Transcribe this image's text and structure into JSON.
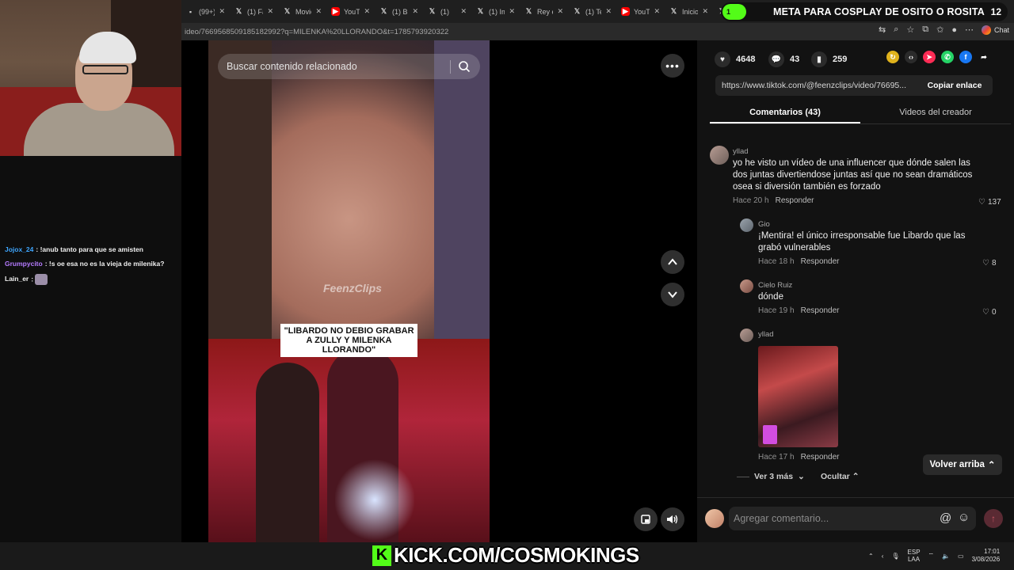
{
  "browser": {
    "tabs": [
      {
        "label": "(99+)",
        "icon": "generic-icon"
      },
      {
        "label": "(1) Fac",
        "icon": "x-icon"
      },
      {
        "label": "Movie",
        "icon": "x-icon"
      },
      {
        "label": "YouTu",
        "icon": "youtube-icon"
      },
      {
        "label": "(1) Bu",
        "icon": "x-icon"
      },
      {
        "label": "(1) ",
        "icon": "x-icon"
      },
      {
        "label": "(1) Im",
        "icon": "x-icon"
      },
      {
        "label": "Rey e",
        "icon": "x-icon"
      },
      {
        "label": "(1) Te",
        "icon": "x-icon"
      },
      {
        "label": "YouTu",
        "icon": "youtube-icon"
      },
      {
        "label": "Inicio",
        "icon": "x-icon"
      },
      {
        "label": "",
        "icon": "x-icon"
      }
    ],
    "url": "ideo/7669568509185182992?q=MILENKA%20LLORANDO&t=1785793920322",
    "chat_label": "Chat"
  },
  "stream": {
    "goal_pill": "1",
    "goal_text": "META PARA COSPLAY DE OSITO O ROSITA",
    "goal_count": "12",
    "chat": [
      {
        "user": "Jojox_24",
        "message": "!anub tanto para que se amisten",
        "color": "#3ea6ff"
      },
      {
        "user": "Grumpycito",
        "message": "!s oe esa no es la vieja de milenika?",
        "color": "#b57bff"
      },
      {
        "user": "Lain_er",
        "message": "",
        "color": "#ffffff"
      }
    ],
    "kick_text": "KICK.COM/COSMOKINGS",
    "kick_letter": "K"
  },
  "video": {
    "search_placeholder": "Buscar contenido relacionado",
    "caption": "\"LIBARDO NO DEBIO GRABAR A ZULLY Y MILENKA LLORANDO\"",
    "watermark": "FeenzClips"
  },
  "panel": {
    "likes": "4648",
    "comments_count": "43",
    "saves": "259",
    "share_link": "https://www.tiktok.com/@feenzclips/video/76695...",
    "copy_label": "Copiar enlace",
    "tab_comments": "Comentarios (43)",
    "tab_creator": "Videos del creador",
    "comments": [
      {
        "user": "yllad",
        "text": "yo he visto un vídeo de una influencer que dónde salen las dos juntas divertiendose juntas así que no sean dramáticos osea si diversión también es forzado",
        "time": "Hace 20 h",
        "reply": "Responder",
        "likes": "137"
      },
      {
        "user": "Gio",
        "text": "¡Mentira! el único irresponsable fue Libardo que las grabó vulnerables",
        "time": "Hace 18 h",
        "reply": "Responder",
        "likes": "8"
      },
      {
        "user": "Cielo Ruiz",
        "text": "dónde",
        "time": "Hace 19 h",
        "reply": "Responder",
        "likes": "0"
      },
      {
        "user": "yllad",
        "text": "",
        "time": "Hace 17 h",
        "reply": "Responder",
        "likes": ""
      }
    ],
    "back_to_top": "Volver arriba",
    "show_more": "Ver 3 más",
    "hide": "Ocultar",
    "comment_placeholder": "Agregar comentario..."
  },
  "taskbar": {
    "lang_top": "ESP",
    "lang_bottom": "LAA",
    "time": "17:01",
    "date": "3/08/2026"
  },
  "colors": {
    "background": "#121212",
    "kick_green": "#53fc18",
    "accent_red": "#fe2c55"
  }
}
